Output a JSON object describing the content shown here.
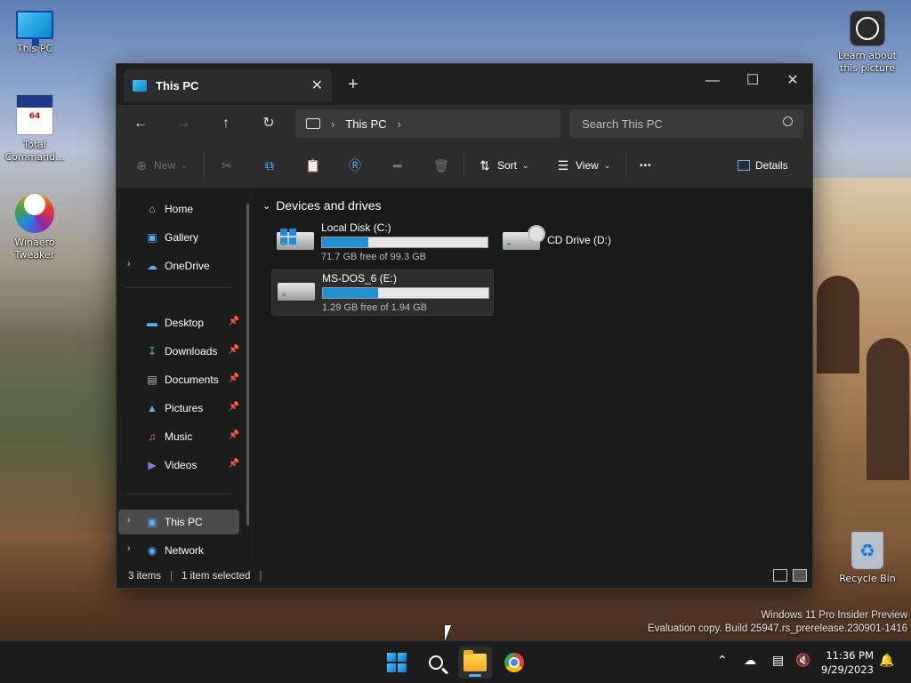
{
  "desktop": {
    "icons": [
      {
        "label": "This PC"
      },
      {
        "label": "Total Command..."
      },
      {
        "label": "Winaero Tweaker"
      },
      {
        "label": "Learn about this picture"
      },
      {
        "label": "Recycle Bin"
      }
    ],
    "tc_badge": "64",
    "watermark": {
      "line1": "Windows 11 Pro Insider Preview",
      "line2": "Evaluation copy. Build 25947.rs_prerelease.230901-1416"
    }
  },
  "window": {
    "tab_title": "This PC",
    "new_tab_symbol": "+",
    "address": {
      "location": "This PC"
    },
    "search": {
      "placeholder": "Search This PC"
    },
    "toolbar": {
      "new_label": "New",
      "sort_label": "Sort",
      "view_label": "View",
      "more_label": "•••",
      "details_label": "Details"
    },
    "sidebar": {
      "items": [
        {
          "label": "Home"
        },
        {
          "label": "Gallery"
        },
        {
          "label": "OneDrive"
        },
        {
          "label": "Desktop"
        },
        {
          "label": "Downloads"
        },
        {
          "label": "Documents"
        },
        {
          "label": "Pictures"
        },
        {
          "label": "Music"
        },
        {
          "label": "Videos"
        },
        {
          "label": "This PC"
        },
        {
          "label": "Network"
        }
      ]
    },
    "content": {
      "group_title": "Devices and drives",
      "drives": [
        {
          "name": "Local Disk (C:)",
          "free_text": "71.7 GB free of 99.3 GB",
          "used_fraction": 0.278
        },
        {
          "name": "CD Drive (D:)"
        },
        {
          "name": "MS-DOS_6 (E:)",
          "free_text": "1.29 GB free of 1.94 GB",
          "used_fraction": 0.335
        }
      ]
    },
    "status": {
      "items_count": "3 items",
      "selected": "1 item selected"
    }
  },
  "taskbar": {
    "clock_time": "11:36 PM",
    "clock_date": "9/29/2023"
  }
}
